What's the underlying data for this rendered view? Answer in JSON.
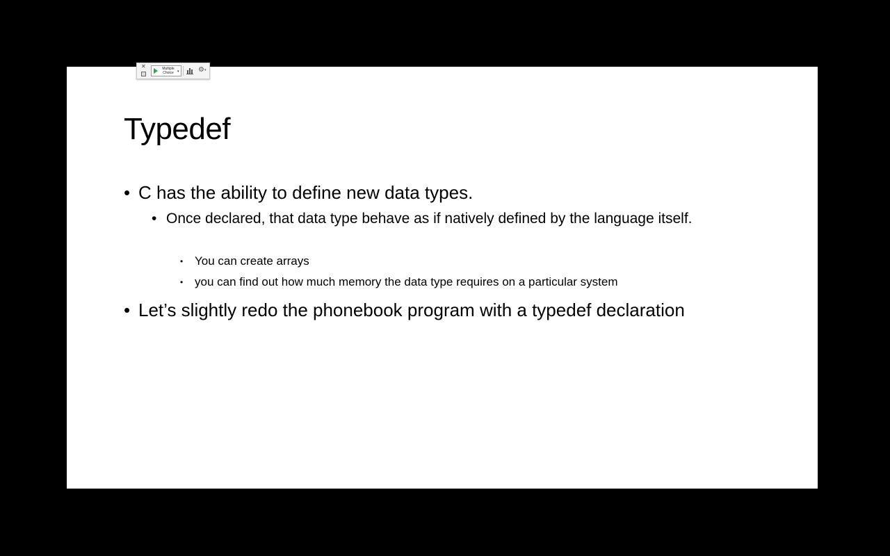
{
  "poll_toolbar": {
    "close_icon": "close-icon",
    "start_button_label": "Multiple Choice",
    "dropdown_icon": "chevron-down-icon",
    "results_icon": "bar-chart-icon",
    "settings_icon": "gear-icon"
  },
  "slide": {
    "title": "Typedef",
    "bullets": [
      {
        "text": "C has the ability to define new data types.",
        "children": [
          {
            "text": "Once declared, that data type behave as if natively defined by the language itself.",
            "children": [
              {
                "text": "You can create arrays"
              },
              {
                "text": "you can find out how much memory the data type requires on a particular system"
              }
            ]
          }
        ]
      },
      {
        "text": "Let’s slightly redo the phonebook program with a typedef declaration"
      }
    ]
  },
  "colors": {
    "background": "#000000",
    "slide": "#ffffff",
    "text": "#000000",
    "play_accent": "#2fa84f"
  }
}
